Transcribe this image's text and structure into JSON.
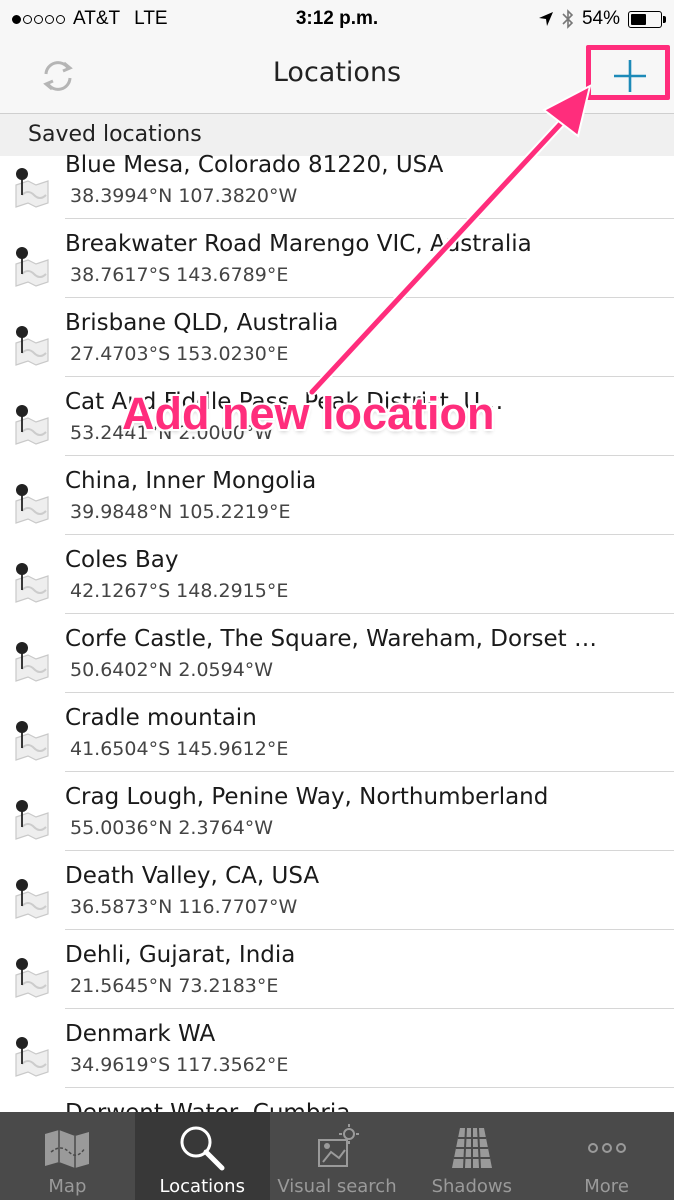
{
  "status_bar": {
    "carrier": "AT&T",
    "network": "LTE",
    "time": "3:12 p.m.",
    "battery": "54%",
    "battery_level": 0.54,
    "signal_bars": 1
  },
  "nav": {
    "title": "Locations",
    "left_icon": "refresh-icon",
    "right_icon": "plus-icon",
    "accent_color": "#1d8ab8"
  },
  "section": {
    "title": "Saved locations"
  },
  "locations": [
    {
      "name": "Blue Mesa, Colorado 81220, USA",
      "coords": "38.3994°N 107.3820°W"
    },
    {
      "name": "Breakwater Road Marengo VIC, Australia",
      "coords": "38.7617°S 143.6789°E"
    },
    {
      "name": "Brisbane QLD, Australia",
      "coords": "27.4703°S 153.0230°E"
    },
    {
      "name": "Cat And Fiddle Pass, Peak District, U…",
      "coords": "53.2441°N 2.0000°W"
    },
    {
      "name": "China, Inner Mongolia",
      "coords": "39.9848°N 105.2219°E"
    },
    {
      "name": "Coles Bay",
      "coords": "42.1267°S 148.2915°E"
    },
    {
      "name": "Corfe Castle, The Square, Wareham, Dorset B…",
      "coords": "50.6402°N 2.0594°W"
    },
    {
      "name": "Cradle mountain",
      "coords": "41.6504°S 145.9612°E"
    },
    {
      "name": "Crag Lough, Penine Way, Northumberland",
      "coords": "55.0036°N 2.3764°W"
    },
    {
      "name": "Death Valley, CA, USA",
      "coords": "36.5873°N 116.7707°W"
    },
    {
      "name": "Dehli, Gujarat, India",
      "coords": "21.5645°N 73.2183°E"
    },
    {
      "name": "Denmark WA",
      "coords": "34.9619°S 117.3562°E"
    },
    {
      "name": "Derwent Water, Cumbria",
      "coords": ""
    }
  ],
  "annotation": {
    "text": "Add new location",
    "color": "#ff2d7c"
  },
  "tab_bar": {
    "tabs": [
      {
        "label": "Map",
        "icon": "map-icon",
        "active": false
      },
      {
        "label": "Locations",
        "icon": "magnifier-icon",
        "active": true
      },
      {
        "label": "Visual search",
        "icon": "visual-search-icon",
        "active": false
      },
      {
        "label": "Shadows",
        "icon": "shadows-checker-icon",
        "active": false
      },
      {
        "label": "More",
        "icon": "more-dots-icon",
        "active": false
      }
    ]
  }
}
